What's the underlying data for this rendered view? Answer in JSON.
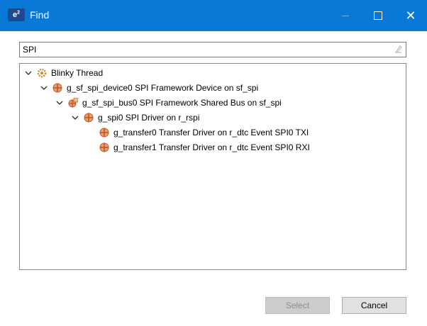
{
  "window": {
    "title": "Find",
    "app_icon_text": "e",
    "app_icon_sup": "2",
    "controls": {
      "minimize": "minimize-icon",
      "maximize": "maximize-icon",
      "close": "close-icon"
    }
  },
  "search": {
    "value": "SPI",
    "clear_icon": "eraser-icon"
  },
  "tree": {
    "items": [
      {
        "label": "Blinky Thread",
        "icon": "gear-icon",
        "expanded": true
      },
      {
        "label": "g_sf_spi_device0 SPI Framework Device on sf_spi",
        "icon": "module-icon",
        "expanded": true
      },
      {
        "label": "g_sf_spi_bus0 SPI Framework Shared Bus on sf_spi",
        "icon": "shared-module-icon",
        "expanded": true
      },
      {
        "label": "g_spi0 SPI Driver on r_rspi",
        "icon": "module-icon",
        "expanded": true
      },
      {
        "label": "g_transfer0 Transfer Driver on r_dtc Event SPI0 TXI",
        "icon": "module-icon"
      },
      {
        "label": "g_transfer1 Transfer Driver on r_dtc Event SPI0 RXI",
        "icon": "module-icon"
      }
    ]
  },
  "buttons": {
    "select": "Select",
    "cancel": "Cancel"
  },
  "colors": {
    "titlebar": "#0a78d7",
    "module_icon": "#c0562d",
    "gear_icon": "#c98a2b"
  }
}
